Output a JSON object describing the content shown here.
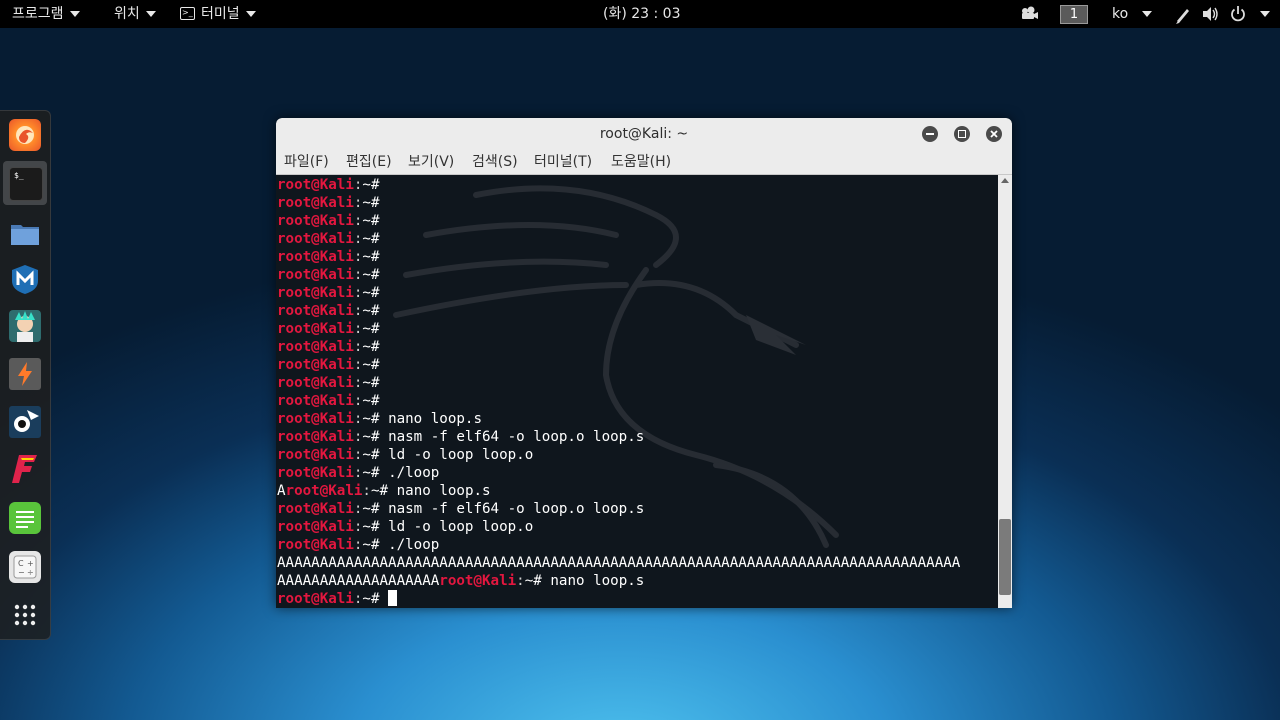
{
  "topbar": {
    "programs_label": "프로그램",
    "places_label": "위치",
    "app_label": "터미널",
    "clock": "(화) 23 : 03",
    "workspace": "1",
    "lang": "ko"
  },
  "dock": {
    "items": [
      "firefox-icon",
      "terminal-icon",
      "files-icon",
      "metasploit-icon",
      "armitage-icon",
      "burpsuite-icon",
      "maltego-icon",
      "faraday-icon",
      "text-editor-icon",
      "calculator-icon",
      "show-apps-icon"
    ]
  },
  "window": {
    "title": "root@Kali: ~",
    "menu": [
      "파일(F)",
      "편집(E)",
      "보기(V)",
      "검색(S)",
      "터미널(T)",
      "도움말(H)"
    ]
  },
  "terminal": {
    "user": "root@Kali",
    "path_sep": ":",
    "prompt_tail": "~#",
    "lines": [
      {
        "pre": "",
        "cmd": ""
      },
      {
        "pre": "",
        "cmd": ""
      },
      {
        "pre": "",
        "cmd": ""
      },
      {
        "pre": "",
        "cmd": ""
      },
      {
        "pre": "",
        "cmd": ""
      },
      {
        "pre": "",
        "cmd": ""
      },
      {
        "pre": "",
        "cmd": ""
      },
      {
        "pre": "",
        "cmd": ""
      },
      {
        "pre": "",
        "cmd": ""
      },
      {
        "pre": "",
        "cmd": ""
      },
      {
        "pre": "",
        "cmd": ""
      },
      {
        "pre": "",
        "cmd": ""
      },
      {
        "pre": "",
        "cmd": ""
      },
      {
        "pre": "",
        "cmd": "nano loop.s"
      },
      {
        "pre": "",
        "cmd": "nasm -f elf64 -o loop.o loop.s"
      },
      {
        "pre": "",
        "cmd": "ld -o loop loop.o"
      },
      {
        "pre": "",
        "cmd": "./loop"
      },
      {
        "pre": "A",
        "cmd": "nano loop.s"
      },
      {
        "pre": "",
        "cmd": "nasm -f elf64 -o loop.o loop.s"
      },
      {
        "pre": "",
        "cmd": "ld -o loop loop.o"
      },
      {
        "pre": "",
        "cmd": "./loop"
      }
    ],
    "output_line": "AAAAAAAAAAAAAAAAAAAAAAAAAAAAAAAAAAAAAAAAAAAAAAAAAAAAAAAAAAAAAAAAAAAAAAAAAAAAAAAA",
    "wrap_pre": "AAAAAAAAAAAAAAAAAAA",
    "wrap_cmd": "nano loop.s",
    "last_cmd": ""
  }
}
